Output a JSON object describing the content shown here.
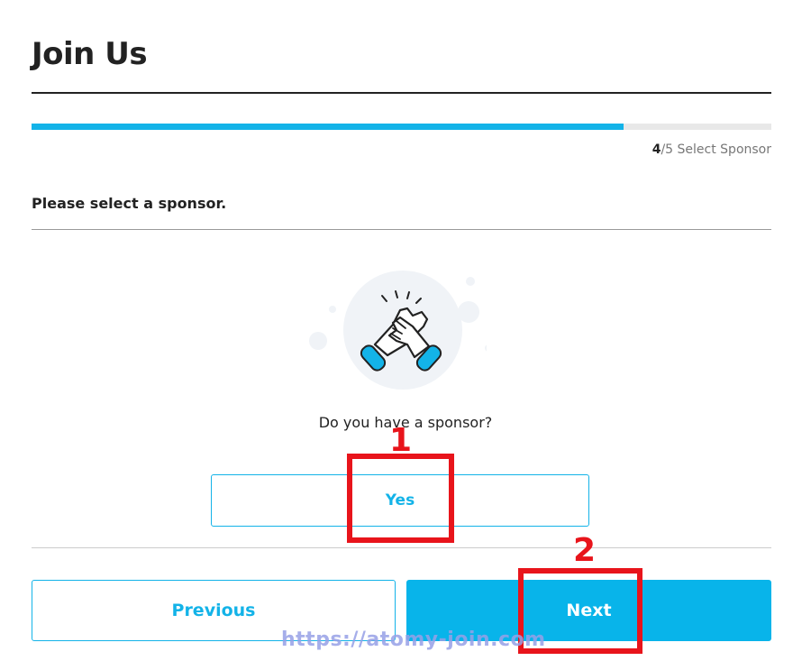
{
  "header": {
    "title": "Join Us"
  },
  "progress": {
    "current": "4",
    "rest": "/5 Select Sponsor",
    "fraction": 0.8
  },
  "instruction": "Please select a sponsor.",
  "question": "Do you have a sponsor?",
  "buttons": {
    "yes": "Yes",
    "previous": "Previous",
    "next": "Next"
  },
  "annotations": {
    "one": "1",
    "two": "2"
  },
  "watermark": "https://atomy-join.com",
  "colors": {
    "accent": "#13b3e8",
    "annotation": "#e8141b"
  },
  "icons": {
    "illustration": "handshake-icon"
  }
}
